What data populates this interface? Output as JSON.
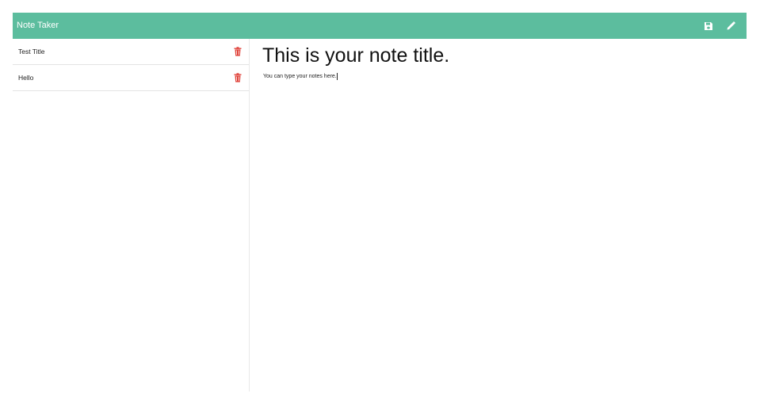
{
  "header": {
    "brand": "Note Taker",
    "save_icon": "save-icon",
    "new_icon": "pencil-icon"
  },
  "sidebar": {
    "notes": [
      {
        "title": "Test Title",
        "delete_icon": "trash-icon"
      },
      {
        "title": "Hello",
        "delete_icon": "trash-icon"
      }
    ]
  },
  "editor": {
    "title": "This is your note title.",
    "text": "You can type your notes here."
  },
  "colors": {
    "navbar": "#5cbd9e",
    "delete": "#e0443c"
  }
}
